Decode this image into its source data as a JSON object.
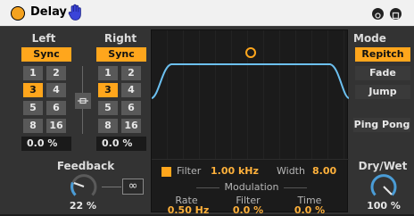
{
  "device": {
    "title": "Delay",
    "accent": "#ffa61c"
  },
  "left": {
    "label": "Left",
    "sync_label": "Sync",
    "buttons": [
      "1",
      "2",
      "3",
      "4",
      "5",
      "6",
      "8",
      "16"
    ],
    "selected": "3",
    "offset": "0.0 %"
  },
  "right": {
    "label": "Right",
    "sync_label": "Sync",
    "buttons": [
      "1",
      "2",
      "3",
      "4",
      "5",
      "6",
      "8",
      "16"
    ],
    "selected": "3",
    "offset": "0.0 %"
  },
  "feedback": {
    "label": "Feedback",
    "value": "22 %",
    "freeze_symbol": "∞",
    "level": 0.22
  },
  "filter": {
    "label": "Filter",
    "freq": "1.00 kHz",
    "width_label": "Width",
    "width": "8.00",
    "enabled": true
  },
  "modulation": {
    "title": "Modulation",
    "rate_label": "Rate",
    "rate": "0.50 Hz",
    "filter_label": "Filter",
    "filter": "0.0 %",
    "time_label": "Time",
    "time": "0.0 %"
  },
  "mode": {
    "label": "Mode",
    "options": [
      "Repitch",
      "Fade",
      "Jump"
    ],
    "selected": "Repitch",
    "ping_pong": "Ping Pong"
  },
  "drywet": {
    "label": "Dry/Wet",
    "value": "100 %",
    "level": 1.0
  }
}
